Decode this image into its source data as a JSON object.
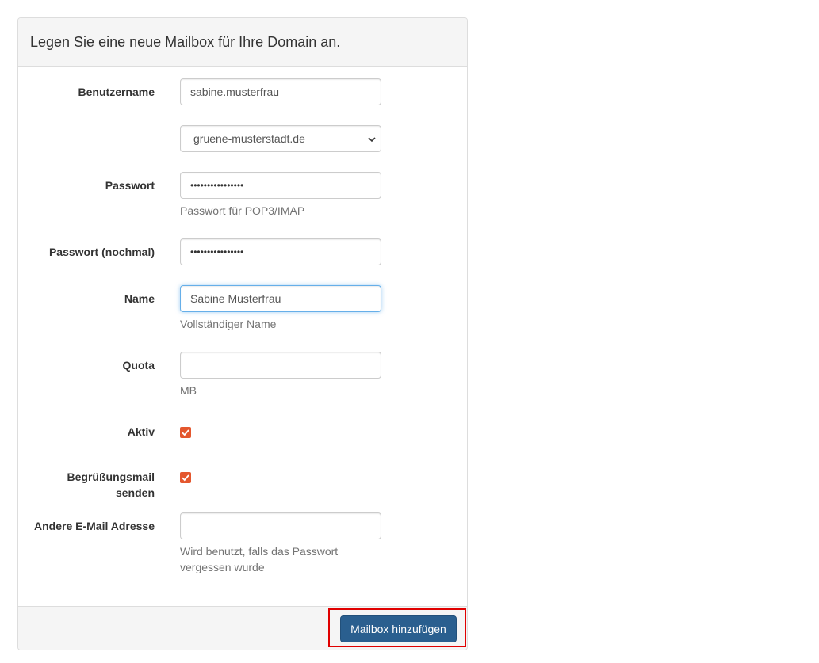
{
  "panel": {
    "heading": "Legen Sie eine neue Mailbox für Ihre Domain an."
  },
  "form": {
    "username": {
      "label": "Benutzername",
      "value": "sabine.musterfrau"
    },
    "domain": {
      "value": "gruene-musterstadt.de"
    },
    "password": {
      "label": "Passwort",
      "masked_value": "••••••••••••••••",
      "help": "Passwort für POP3/IMAP"
    },
    "password_repeat": {
      "label": "Passwort (nochmal)",
      "masked_value": "••••••••••••••••"
    },
    "name": {
      "label": "Name",
      "value": "Sabine Musterfrau",
      "help": "Vollständiger Name"
    },
    "quota": {
      "label": "Quota",
      "value": "",
      "help": "MB"
    },
    "active": {
      "label": "Aktiv",
      "checked": true
    },
    "welcome_mail": {
      "label_line1": "Begrüßungsmail",
      "label_line2": "senden",
      "checked": true
    },
    "other_email": {
      "label": "Andere E-Mail Adresse",
      "value": "",
      "help_line1": "Wird benutzt, falls das Passwort",
      "help_line2": "vergessen wurde"
    }
  },
  "footer": {
    "submit_label": "Mailbox hinzufügen"
  },
  "colors": {
    "checkbox": "#e4572e",
    "primary_button": "#2a5f8f",
    "highlight_box": "#e00000",
    "panel_bg": "#f5f5f5"
  }
}
